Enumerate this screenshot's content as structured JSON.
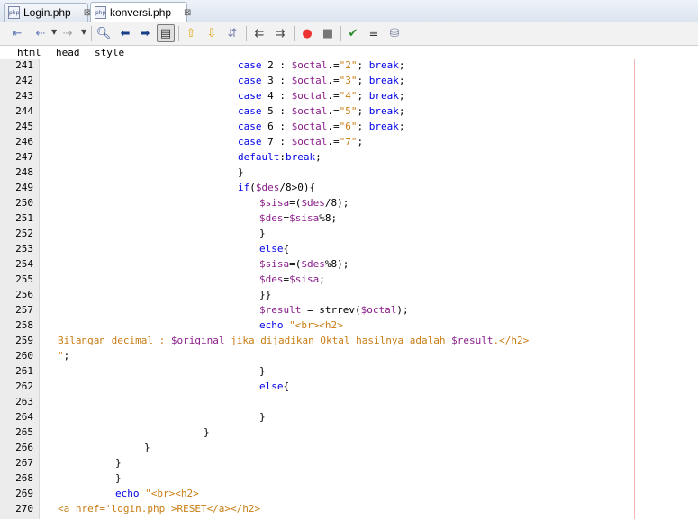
{
  "tabs": [
    {
      "label": "Login.php",
      "icon": "php-file-icon",
      "close": "⊠"
    },
    {
      "label": "konversi.php",
      "icon": "php-file-icon",
      "close": "⊠"
    }
  ],
  "breadcrumb": [
    "html",
    "head",
    "style"
  ],
  "line_numbers": [
    "241",
    "242",
    "243",
    "244",
    "245",
    "246",
    "247",
    "248",
    "249",
    "250",
    "251",
    "252",
    "253",
    "254",
    "255",
    "256",
    "257",
    "258",
    "259",
    "260",
    "261",
    "262",
    "263",
    "264",
    "265",
    "266",
    "267",
    "268",
    "269",
    "270"
  ],
  "code": {
    "l241": {
      "kw1": "case",
      "t1": " 2 : ",
      "var": "$octal",
      "t2": ".=",
      "str": "\"2\"",
      "t3": "; ",
      "kw2": "break",
      "t4": ";"
    },
    "l242": {
      "kw1": "case",
      "t1": " 3 : ",
      "var": "$octal",
      "t2": ".=",
      "str": "\"3\"",
      "t3": "; ",
      "kw2": "break",
      "t4": ";"
    },
    "l243": {
      "kw1": "case",
      "t1": " 4 : ",
      "var": "$octal",
      "t2": ".=",
      "str": "\"4\"",
      "t3": "; ",
      "kw2": "break",
      "t4": ";"
    },
    "l244": {
      "kw1": "case",
      "t1": " 5 : ",
      "var": "$octal",
      "t2": ".=",
      "str": "\"5\"",
      "t3": "; ",
      "kw2": "break",
      "t4": ";"
    },
    "l245": {
      "kw1": "case",
      "t1": " 6 : ",
      "var": "$octal",
      "t2": ".=",
      "str": "\"6\"",
      "t3": "; ",
      "kw2": "break",
      "t4": ";"
    },
    "l246": {
      "kw1": "case",
      "t1": " 7 : ",
      "var": "$octal",
      "t2": ".=",
      "str": "\"7\"",
      "t3": ";"
    },
    "l247": {
      "kw1": "default",
      "t1": ":",
      "kw2": "break",
      "t2": ";"
    },
    "l248": {
      "t1": "}"
    },
    "l249": {
      "kw1": "if",
      "t1": "(",
      "var": "$des",
      "t2": "/8>0){"
    },
    "l250": {
      "var1": "$sisa",
      "t1": "=(",
      "var2": "$des",
      "t2": "/8);"
    },
    "l251": {
      "var1": "$des",
      "t1": "=",
      "var2": "$sisa",
      "t2": "%8;"
    },
    "l252": {
      "t1": "}"
    },
    "l253": {
      "kw1": "else",
      "t1": "{"
    },
    "l254": {
      "var1": "$sisa",
      "t1": "=(",
      "var2": "$des",
      "t2": "%8);"
    },
    "l255": {
      "var1": "$des",
      "t1": "=",
      "var2": "$sisa",
      "t2": ";"
    },
    "l256": {
      "t1": "}}"
    },
    "l257": {
      "var1": "$result",
      "t1": " = strrev(",
      "var2": "$octal",
      "t2": ");"
    },
    "l258": {
      "kw1": "echo",
      "s1": " \"<br><h2>"
    },
    "l259": {
      "s1": "Bilangan decimal : ",
      "var1": "$original",
      "s2": " jika dijadikan Oktal hasilnya adalah ",
      "var2": "$result",
      "s3": ".</h2>"
    },
    "l260": {
      "s1": "\"",
      "t1": ";"
    },
    "l261": {
      "t1": "}"
    },
    "l262": {
      "kw1": "else",
      "t1": "{"
    },
    "l263": {},
    "l264": {
      "t1": "}"
    },
    "l265": {
      "t1": "}"
    },
    "l266": {
      "t1": "}"
    },
    "l267": {
      "t1": "}"
    },
    "l268": {
      "t1": "}"
    },
    "l269": {
      "kw1": "echo",
      "s1": " \"<br><h2>"
    },
    "l270": {
      "s1": "<a href='login.php'>RESET</a></h2>"
    }
  },
  "colors": {
    "keyword": "#0000e6",
    "variable": "#8a1e8a",
    "string": "#c87d13"
  }
}
